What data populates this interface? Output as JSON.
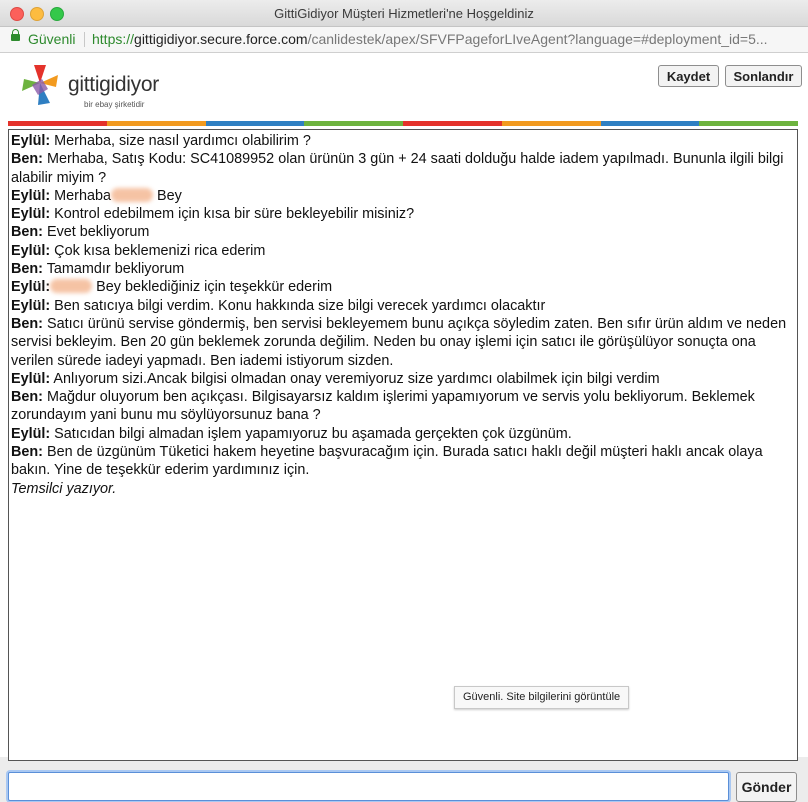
{
  "window": {
    "title": "GittiGidiyor Müşteri Hizmetleri'ne Hoşgeldiniz"
  },
  "urlbar": {
    "secure_label": "Güvenli",
    "scheme": "https://",
    "host": "gittigidiyor.secure.force.com",
    "path": "/canlidestek/apex/SFVFPageforLIveAgent?language=#deployment_id=5..."
  },
  "logo": {
    "name": "gittigidiyor",
    "sub": "bir ebay şirketidir"
  },
  "toolbar": {
    "save_label": "Kaydet",
    "end_label": "Sonlandır"
  },
  "stripe_colors": [
    "#e4322b",
    "#f29a1f",
    "#2f7fc2",
    "#6db33f",
    "#e4322b",
    "#f29a1f",
    "#2f7fc2",
    "#6db33f"
  ],
  "chat": {
    "messages": [
      {
        "speaker": "Eylül:",
        "text": " Merhaba, size nasıl yardımcı olabilirim ?"
      },
      {
        "speaker": "Ben:",
        "text": " Merhaba, Satış Kodu: SC41089952 olan ürünün 3 gün + 24 saati dolduğu halde iadem yapılmadı. Bununla ilgili bilgi alabilir miyim ?"
      },
      {
        "speaker": "Eylül:",
        "text": " Merhaba",
        "redacted": true,
        "text_after": " Bey"
      },
      {
        "speaker": "Eylül:",
        "text": " Kontrol edebilmem için kısa bir süre bekleyebilir misiniz?"
      },
      {
        "speaker": "Ben:",
        "text": " Evet bekliyorum"
      },
      {
        "speaker": "Eylül:",
        "text": " Çok kısa beklemenizi rica ederim"
      },
      {
        "speaker": "Ben:",
        "text": " Tamamdır bekliyorum"
      },
      {
        "speaker": "Eylül:",
        "text": "",
        "redacted": true,
        "text_after": " Bey beklediğiniz için teşekkür ederim"
      },
      {
        "speaker": "Eylül:",
        "text": " Ben satıcıya bilgi verdim. Konu hakkında size bilgi verecek yardımcı olacaktır"
      },
      {
        "speaker": "Ben:",
        "text": " Satıcı ürünü servise göndermiş, ben servisi bekleyemem bunu açıkça söyledim zaten. Ben sıfır ürün aldım ve neden servisi bekleyim. Ben 20 gün beklemek zorunda değilim. Neden bu onay işlemi için satıcı ile görüşülüyor sonuçta ona verilen sürede iadeyi yapmadı. Ben iademi istiyorum sizden."
      },
      {
        "speaker": "Eylül:",
        "text": " Anlıyorum sizi.Ancak bilgisi olmadan onay veremiyoruz size yardımcı olabilmek için bilgi verdim"
      },
      {
        "speaker": "Ben:",
        "text": " Mağdur oluyorum ben açıkçası. Bilgisayarsız kaldım işlerimi yapamıyorum ve servis yolu bekliyorum. Beklemek zorundayım yani bunu mu söylüyorsunuz bana ?"
      },
      {
        "speaker": "Eylül:",
        "text": " Satıcıdan bilgi almadan işlem yapamıyoruz bu aşamada gerçekten çok üzgünüm."
      },
      {
        "speaker": "Ben:",
        "text": " Ben de üzgünüm Tüketici hakem heyetine başvuracağım için. Burada satıcı haklı değil müşteri haklı ancak olaya bakın. Yine de teşekkür ederim yardımınız için."
      }
    ],
    "typing_indicator": "Temsilci yazıyor."
  },
  "tooltip": {
    "text": "Güvenli. Site bilgilerini görüntüle"
  },
  "composer": {
    "input_value": "",
    "send_label": "Gönder"
  }
}
